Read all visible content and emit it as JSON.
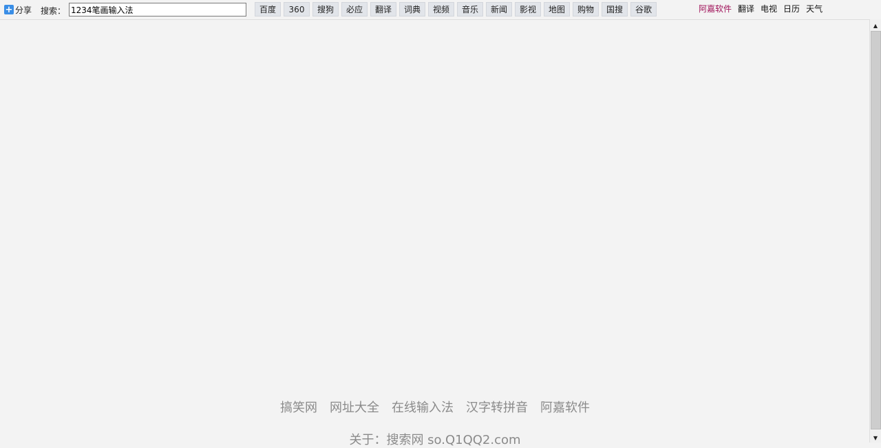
{
  "toolbar": {
    "share_label": "分享",
    "search_label": "搜索：",
    "search_value": "1234笔画输入法",
    "engines": [
      "百度",
      "360",
      "搜狗",
      "必应",
      "翻译",
      "词典",
      "视频",
      "音乐",
      "新闻",
      "影视",
      "地图",
      "购物",
      "国搜",
      "谷歌"
    ]
  },
  "right_links": {
    "brand": "阿嘉软件",
    "translate": "翻译",
    "tv": "电视",
    "calendar": "日历",
    "weather": "天气"
  },
  "footer": {
    "links": [
      "搞笑网",
      "网址大全",
      "在线输入法",
      "汉字转拼音",
      "阿嘉软件"
    ],
    "about": "关于：搜索网 so.Q1QQ2.com"
  },
  "colors": {
    "background": "#f3f3f3",
    "brand_link": "#a0135a",
    "footer_text": "#8a8a8a",
    "engine_button": "#e2e5ea"
  }
}
